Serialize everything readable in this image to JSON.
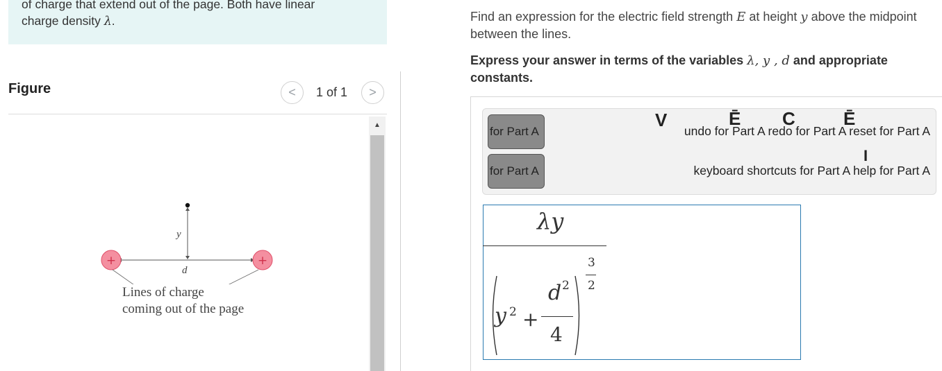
{
  "problem": {
    "line1": "of charge that extend out of the page. Both have linear",
    "line2_prefix": "charge density ",
    "line2_symbol": "λ",
    "line2_suffix": "."
  },
  "figure": {
    "label": "Figure",
    "pager_count": "1 of 1",
    "prev_icon": "chevron-left-icon",
    "next_icon": "chevron-right-icon",
    "prev_glyph": "<",
    "next_glyph": ">",
    "label_y": "y",
    "label_d": "d",
    "plus": "+",
    "caption_line1": "Lines of charge",
    "caption_line2": "coming out of the page",
    "charge_color": "#f48fa0",
    "charge_stroke": "#e0506a"
  },
  "question": {
    "text_part1": "Find an expression for the electric field strength ",
    "var_E": "E",
    "text_part2": " at height ",
    "var_y": "y",
    "text_part3": " above the midpoint between the lines."
  },
  "instruction": {
    "prefix": "Express your answer in terms of the variables ",
    "v1": "λ",
    "sep1": ", ",
    "v2": "y",
    "sep2": " , ",
    "v3": "d",
    "suffix": " and appropriate constants."
  },
  "toolbar": {
    "template_btn_1": "for Part A",
    "template_btn_2": "for Part A",
    "undo": "undo for Part A",
    "redo": "redo for Part A",
    "reset": "reset for Part A",
    "keyboard": "keyboard shortcuts for Part A",
    "help": "help for Part A"
  },
  "answer": {
    "numerator": "λy",
    "den_y": "y",
    "den_y_exp": "2",
    "den_plus": "+",
    "inner_num": "d",
    "inner_num_exp": "2",
    "inner_den": "4",
    "exp_num": "3",
    "exp_den": "2",
    "border_color": "#2a7ab0"
  }
}
